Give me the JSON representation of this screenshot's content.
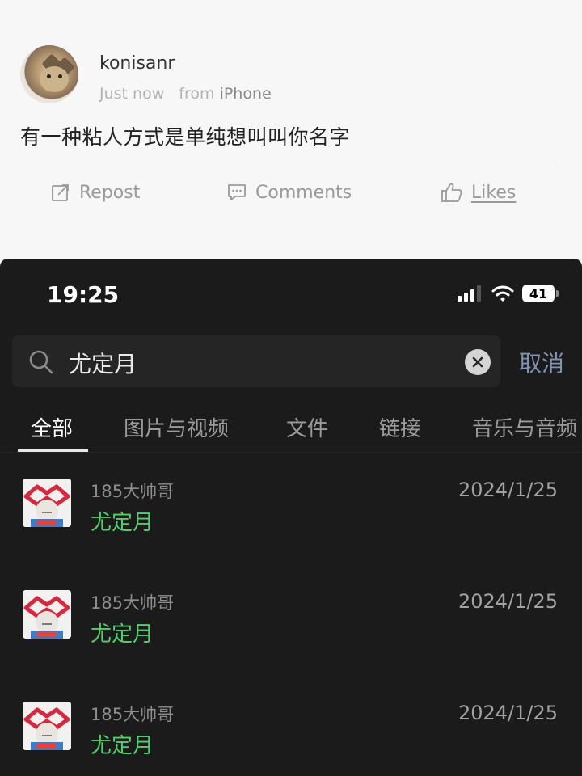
{
  "post": {
    "username": "konisanr",
    "time": "Just now",
    "from_prefix": "from",
    "device": "iPhone",
    "text": "有一种粘人方式是单纯想叫叫你名字",
    "actions": {
      "repost": "Repost",
      "comments": "Comments",
      "likes": "Likes"
    }
  },
  "phone": {
    "status": {
      "time": "19:25",
      "battery": "41"
    },
    "search": {
      "query": "尤定月",
      "cancel": "取消"
    },
    "tabs": [
      {
        "label": "全部",
        "active": true
      },
      {
        "label": "图片与视频"
      },
      {
        "label": "文件"
      },
      {
        "label": "链接"
      },
      {
        "label": "音乐与音频"
      }
    ],
    "results": [
      {
        "sender": "185大帅哥",
        "message": "尤定月",
        "date": "2024/1/25"
      },
      {
        "sender": "185大帅哥",
        "message": "尤定月",
        "date": "2024/1/25"
      },
      {
        "sender": "185大帅哥",
        "message": "尤定月",
        "date": "2024/1/25"
      }
    ]
  },
  "colors": {
    "accent_green": "#4fd16a",
    "cancel_blue": "#7f93b2",
    "dark_bg": "#1b1b1c"
  }
}
